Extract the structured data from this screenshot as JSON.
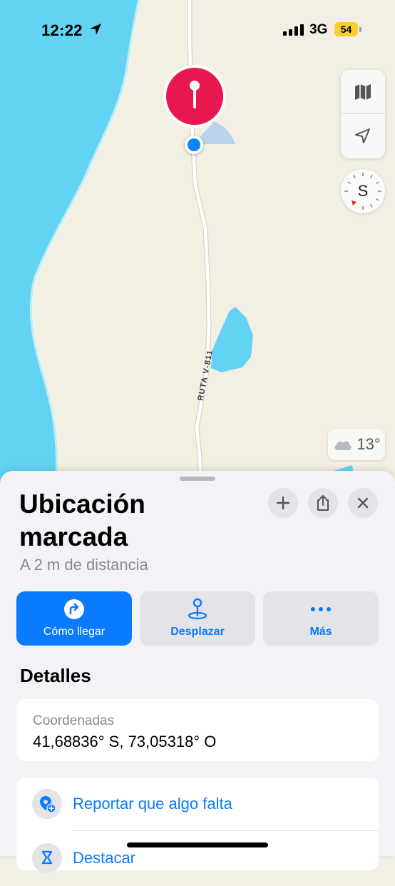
{
  "status_bar": {
    "time": "12:22",
    "network": "3G",
    "battery": "54"
  },
  "map": {
    "road_label": "RUTA V-811",
    "weather_temp": "13°",
    "compass_letter": "S",
    "colors": {
      "land": "#f3efe3",
      "water": "#63d3f3",
      "road": "#ffffff",
      "pin": "#e8174f",
      "user_dot": "#0a84ff"
    }
  },
  "sheet": {
    "title": "Ubicación marcada",
    "subtitle": "A 2 m de distancia",
    "actions": [
      {
        "label": "Cómo llegar",
        "icon": "directions-icon"
      },
      {
        "label": "Desplazar",
        "icon": "move-pin-icon"
      },
      {
        "label": "Más",
        "icon": "more-icon"
      }
    ],
    "details_title": "Detalles",
    "coordinates_label": "Coordenadas",
    "coordinates_value": "41,68836° S, 73,05318° O",
    "links": [
      {
        "label": "Reportar que algo falta",
        "icon": "report-missing-icon"
      },
      {
        "label": "Destacar",
        "icon": "highlight-icon"
      }
    ]
  }
}
